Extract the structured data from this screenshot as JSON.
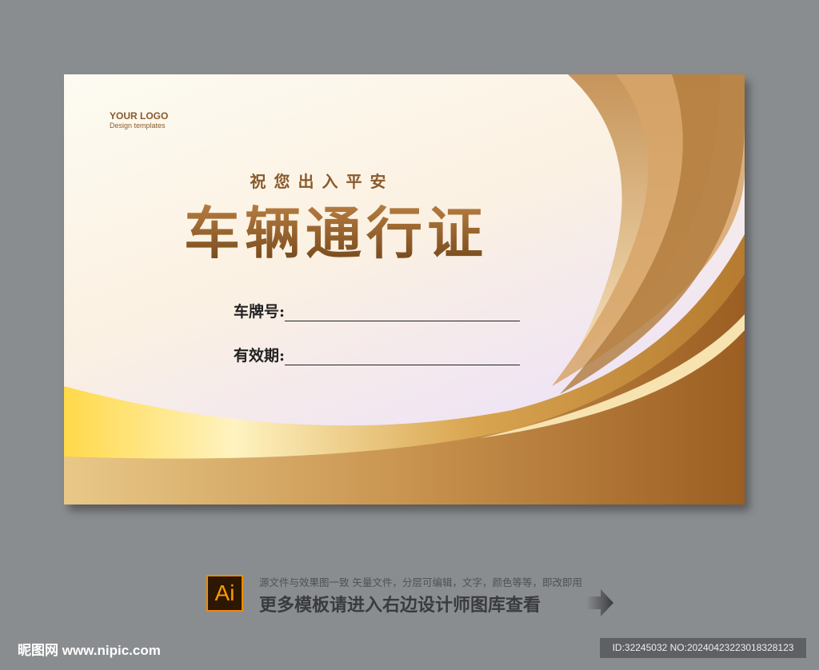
{
  "card": {
    "logo_title": "YOUR LOGO",
    "logo_subtitle": "Design templates",
    "subtitle": "祝您出入平安",
    "title": "车辆通行证",
    "fields": [
      {
        "label": "车牌号:"
      },
      {
        "label": "有效期:"
      }
    ]
  },
  "footer": {
    "ai_badge": "Ai",
    "info_line": "源文件与效果图一致 矢量文件，分层可编辑，文字，颜色等等，即改即用",
    "cta": "更多模板请进入右边设计师图库查看",
    "site": "昵图网 www.nipic.com",
    "id_text": "ID:32245032 NO:20240423223018328123"
  },
  "colors": {
    "gold": "#b07a3c",
    "background": "#8a8d90"
  }
}
